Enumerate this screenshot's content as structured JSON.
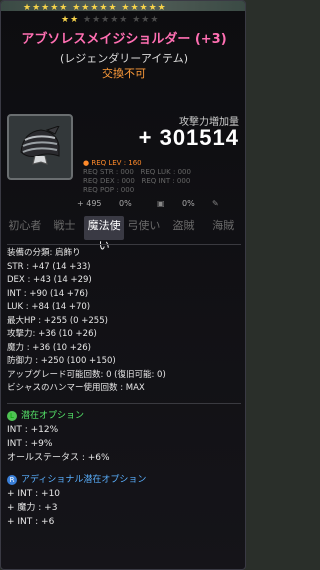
{
  "stars": {
    "row1": "★★★★★ ★★★★★ ★★★★★",
    "row2_on": "★★",
    "row2_off": "★★★★★ ★★★"
  },
  "item": {
    "name": "アブソレスメイジショルダー (+3)",
    "type": "(レジェンダリーアイテム)",
    "trade": "交換不可"
  },
  "attack_increase": {
    "label": "攻撃力増加量",
    "value": "+ 301514"
  },
  "requirements": {
    "lev": "● REQ LEV : 160",
    "str": "REQ STR : 000",
    "luk": "REQ LUK : 000",
    "dex": "REQ DEX : 000",
    "int": "REQ INT : 000",
    "pop": "REQ POP : 000"
  },
  "small_row": {
    "upgrade": "+ 495",
    "pct1": "0%",
    "pct2": "0%"
  },
  "jobs": [
    {
      "label": "初心者",
      "active": false
    },
    {
      "label": "戦士",
      "active": false
    },
    {
      "label": "魔法使い",
      "active": true
    },
    {
      "label": "弓使い",
      "active": false
    },
    {
      "label": "盗賊",
      "active": false
    },
    {
      "label": "海賊",
      "active": false
    }
  ],
  "stats": [
    "装備の分類: 肩飾り",
    "STR : +47 (14 +33)",
    "DEX : +43 (14 +29)",
    "INT : +90 (14 +76)",
    "LUK : +84 (14 +70)",
    "最大HP : +255 (0 +255)",
    "攻撃力: +36 (10 +26)",
    "魔力 : +36 (10 +26)",
    "防御力 : +250 (100 +150)",
    "アップグレード可能回数: 0 (復旧可能: 0)",
    "ビシャスのハンマー使用回数 : MAX"
  ],
  "potential": {
    "title": "潜在オプション",
    "badge": "L",
    "lines": [
      "INT : +12%",
      "INT : +9%",
      "オールステータス : +6%"
    ]
  },
  "additional": {
    "title": "アディショナル潜在オプション",
    "badge": "R",
    "lines": [
      "+ INT : +10",
      "+ 魔力 : +3",
      "+ INT : +6"
    ]
  },
  "colors": {
    "title": "#ff6fb2",
    "trade": "#ff9c3a",
    "potential": "#56e86a",
    "additional": "#5ab0ff"
  }
}
